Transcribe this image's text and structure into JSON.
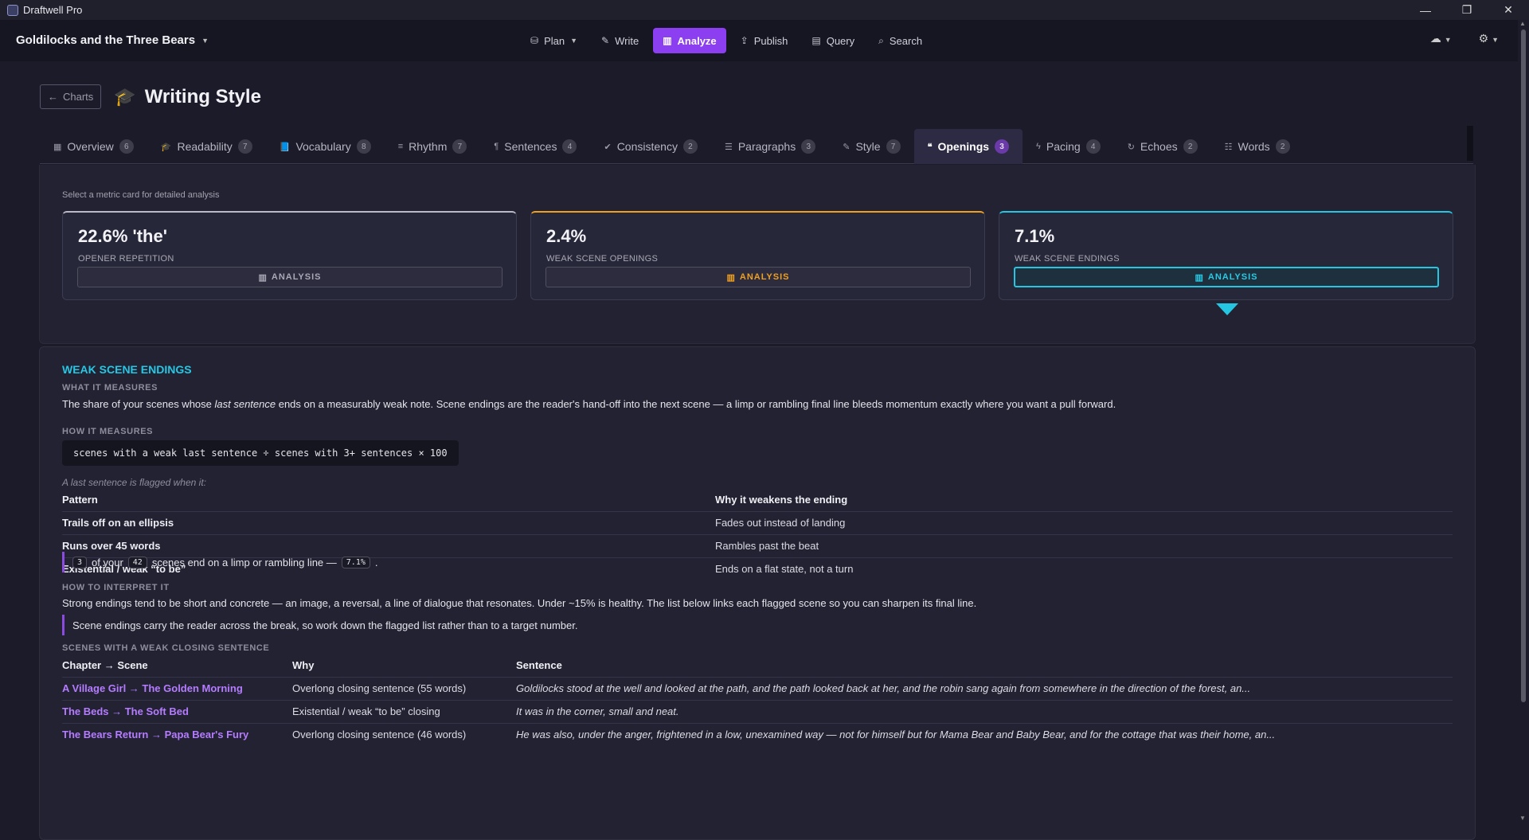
{
  "window": {
    "title": "Draftwell Pro",
    "controls": [
      "—",
      "❐",
      "✕"
    ]
  },
  "topbar": {
    "project": "Goldilocks and the Three Bears",
    "nav": [
      {
        "label": "Plan",
        "icon": "sitemap-icon",
        "glyph": "⛁",
        "dropdown": true
      },
      {
        "label": "Write",
        "icon": "pencil-icon",
        "glyph": "✎"
      },
      {
        "label": "Analyze",
        "icon": "bar-chart-icon",
        "glyph": "▥",
        "active": true
      },
      {
        "label": "Publish",
        "icon": "upload-icon",
        "glyph": "⇪"
      },
      {
        "label": "Query",
        "icon": "table-icon",
        "glyph": "▤"
      },
      {
        "label": "Search",
        "icon": "search-icon",
        "glyph": "⌕"
      }
    ],
    "cloud_icon": "☁",
    "gear_icon": "⚙"
  },
  "header": {
    "back_label": "Charts",
    "title": "Writing Style"
  },
  "tabs": [
    {
      "label": "Overview",
      "count": "6",
      "glyph": "▦",
      "icon": "grid-icon"
    },
    {
      "label": "Readability",
      "count": "7",
      "glyph": "🎓",
      "icon": "graduation-cap-icon"
    },
    {
      "label": "Vocabulary",
      "count": "8",
      "glyph": "📘",
      "icon": "book-icon"
    },
    {
      "label": "Rhythm",
      "count": "7",
      "glyph": "≡",
      "icon": "align-icon"
    },
    {
      "label": "Sentences",
      "count": "4",
      "glyph": "¶",
      "icon": "paragraph-icon"
    },
    {
      "label": "Consistency",
      "count": "2",
      "glyph": "✔",
      "icon": "check-circle-icon"
    },
    {
      "label": "Paragraphs",
      "count": "3",
      "glyph": "☰",
      "icon": "list-icon"
    },
    {
      "label": "Style",
      "count": "7",
      "glyph": "✎",
      "icon": "pencil-icon"
    },
    {
      "label": "Openings",
      "count": "3",
      "glyph": "❝",
      "icon": "quote-icon",
      "active": true
    },
    {
      "label": "Pacing",
      "count": "4",
      "glyph": "ϟ",
      "icon": "bolt-icon"
    },
    {
      "label": "Echoes",
      "count": "2",
      "glyph": "↻",
      "icon": "redo-icon"
    },
    {
      "label": "Words",
      "count": "2",
      "glyph": "☷",
      "icon": "list-ul-icon"
    }
  ],
  "metrics": {
    "hint": "Select a metric card for detailed analysis",
    "cards": [
      {
        "value": "22.6% 'the'",
        "label": "OPENER REPETITION",
        "button": "ANALYSIS"
      },
      {
        "value": "2.4%",
        "label": "WEAK SCENE OPENINGS",
        "button": "ANALYSIS"
      },
      {
        "value": "7.1%",
        "label": "WEAK SCENE ENDINGS",
        "button": "ANALYSIS",
        "selected": true
      }
    ]
  },
  "detail": {
    "title": "WEAK SCENE ENDINGS",
    "what_heading": "WHAT IT MEASURES",
    "what_pre": "The share of your scenes whose ",
    "what_em": "last sentence",
    "what_post": " ends on a measurably weak note. Scene endings are the reader's hand-off into the next scene — a limp or rambling final line bleeds momentum exactly where you want a pull forward.",
    "how_heading": "HOW IT MEASURES",
    "formula": "scenes with a weak last sentence ÷ scenes with 3+ sentences × 100",
    "flag_note": "A last sentence is flagged when it:",
    "pattern_headers": [
      "Pattern",
      "Why it weakens the ending"
    ],
    "patterns": [
      [
        "Trails off on an ellipsis",
        "Fades out instead of landing"
      ],
      [
        "Runs over 45 words",
        "Rambles past the beat"
      ],
      [
        "Existential / weak “to be”",
        "Ends on a flat state, not a turn"
      ]
    ],
    "summary": {
      "count": "3",
      "of_your": "of your",
      "total": "42",
      "text": "scenes end on a limp or rambling line —",
      "pct": "7.1%",
      "end": "."
    },
    "interpret_heading": "HOW TO INTERPRET IT",
    "interpret_text": "Strong endings tend to be short and concrete — an image, a reversal, a line of dialogue that resonates. Under ~15% is healthy. The list below links each flagged scene so you can sharpen its final line.",
    "interpret_quote": "Scene endings carry the reader across the break, so work down the flagged list rather than to a target number.",
    "scenes_heading": "SCENES WITH A WEAK CLOSING SENTENCE",
    "scene_headers": [
      "Chapter → Scene",
      "Why",
      "Sentence"
    ],
    "scenes": [
      {
        "link": "A Village Girl → The Golden Morning",
        "why": "Overlong closing sentence (55 words)",
        "sentence": "Goldilocks stood at the well and looked at the path, and the path looked back at her, and the robin sang again from somewhere in the direction of the forest, an..."
      },
      {
        "link": "The Beds → The Soft Bed",
        "why": "Existential / weak “to be” closing",
        "sentence": "It was in the corner, small and neat."
      },
      {
        "link": "The Bears Return → Papa Bear's Fury",
        "why": "Overlong closing sentence (46 words)",
        "sentence": "He was also, under the anger, frightened in a low, unexamined way — not for himself but for Mama Bear and Baby Bear, and for the cottage that was their home, an..."
      }
    ]
  }
}
